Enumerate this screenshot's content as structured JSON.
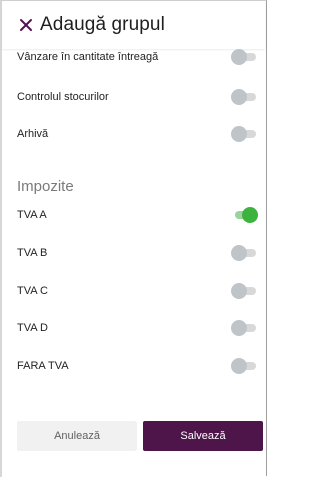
{
  "header": {
    "title": "Adaugă grupul",
    "close_icon": "close-icon"
  },
  "settings": [
    {
      "label": "Vânzare în cantitate întreagă",
      "enabled": false
    },
    {
      "label": "Controlul stocurilor",
      "enabled": false
    },
    {
      "label": "Arhivă",
      "enabled": false
    }
  ],
  "taxes": {
    "title": "Impozite",
    "items": [
      {
        "label": "TVA A",
        "enabled": true
      },
      {
        "label": "TVA B",
        "enabled": false
      },
      {
        "label": "TVA C",
        "enabled": false
      },
      {
        "label": "TVA D",
        "enabled": false
      },
      {
        "label": "FARA TVA",
        "enabled": false
      }
    ]
  },
  "footer": {
    "cancel_label": "Anulează",
    "save_label": "Salvează"
  },
  "colors": {
    "brand": "#4d1549",
    "toggle_on": "#3bb33e",
    "toggle_off": "#bfc4c9"
  }
}
